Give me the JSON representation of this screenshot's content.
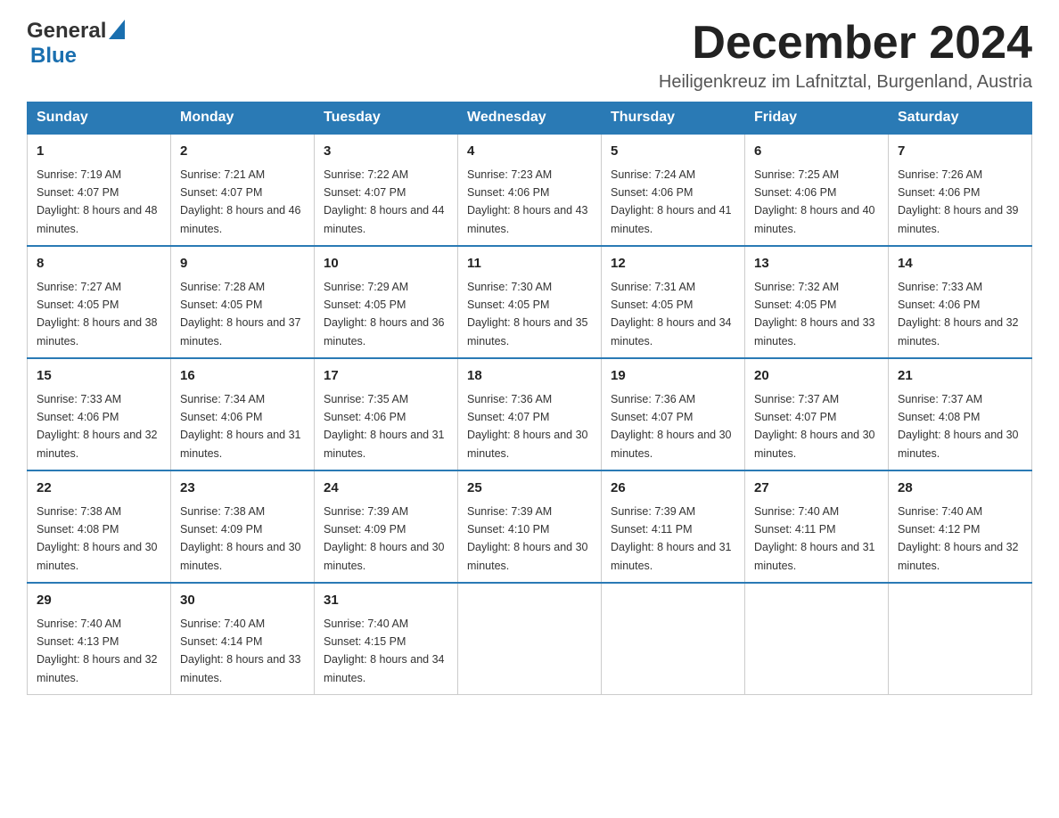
{
  "header": {
    "logo_general": "General",
    "logo_blue": "Blue",
    "month_title": "December 2024",
    "location": "Heiligenkreuz im Lafnitztal, Burgenland, Austria"
  },
  "days_of_week": [
    "Sunday",
    "Monday",
    "Tuesday",
    "Wednesday",
    "Thursday",
    "Friday",
    "Saturday"
  ],
  "weeks": [
    [
      {
        "day": "1",
        "sunrise": "7:19 AM",
        "sunset": "4:07 PM",
        "daylight": "8 hours and 48 minutes."
      },
      {
        "day": "2",
        "sunrise": "7:21 AM",
        "sunset": "4:07 PM",
        "daylight": "8 hours and 46 minutes."
      },
      {
        "day": "3",
        "sunrise": "7:22 AM",
        "sunset": "4:07 PM",
        "daylight": "8 hours and 44 minutes."
      },
      {
        "day": "4",
        "sunrise": "7:23 AM",
        "sunset": "4:06 PM",
        "daylight": "8 hours and 43 minutes."
      },
      {
        "day": "5",
        "sunrise": "7:24 AM",
        "sunset": "4:06 PM",
        "daylight": "8 hours and 41 minutes."
      },
      {
        "day": "6",
        "sunrise": "7:25 AM",
        "sunset": "4:06 PM",
        "daylight": "8 hours and 40 minutes."
      },
      {
        "day": "7",
        "sunrise": "7:26 AM",
        "sunset": "4:06 PM",
        "daylight": "8 hours and 39 minutes."
      }
    ],
    [
      {
        "day": "8",
        "sunrise": "7:27 AM",
        "sunset": "4:05 PM",
        "daylight": "8 hours and 38 minutes."
      },
      {
        "day": "9",
        "sunrise": "7:28 AM",
        "sunset": "4:05 PM",
        "daylight": "8 hours and 37 minutes."
      },
      {
        "day": "10",
        "sunrise": "7:29 AM",
        "sunset": "4:05 PM",
        "daylight": "8 hours and 36 minutes."
      },
      {
        "day": "11",
        "sunrise": "7:30 AM",
        "sunset": "4:05 PM",
        "daylight": "8 hours and 35 minutes."
      },
      {
        "day": "12",
        "sunrise": "7:31 AM",
        "sunset": "4:05 PM",
        "daylight": "8 hours and 34 minutes."
      },
      {
        "day": "13",
        "sunrise": "7:32 AM",
        "sunset": "4:05 PM",
        "daylight": "8 hours and 33 minutes."
      },
      {
        "day": "14",
        "sunrise": "7:33 AM",
        "sunset": "4:06 PM",
        "daylight": "8 hours and 32 minutes."
      }
    ],
    [
      {
        "day": "15",
        "sunrise": "7:33 AM",
        "sunset": "4:06 PM",
        "daylight": "8 hours and 32 minutes."
      },
      {
        "day": "16",
        "sunrise": "7:34 AM",
        "sunset": "4:06 PM",
        "daylight": "8 hours and 31 minutes."
      },
      {
        "day": "17",
        "sunrise": "7:35 AM",
        "sunset": "4:06 PM",
        "daylight": "8 hours and 31 minutes."
      },
      {
        "day": "18",
        "sunrise": "7:36 AM",
        "sunset": "4:07 PM",
        "daylight": "8 hours and 30 minutes."
      },
      {
        "day": "19",
        "sunrise": "7:36 AM",
        "sunset": "4:07 PM",
        "daylight": "8 hours and 30 minutes."
      },
      {
        "day": "20",
        "sunrise": "7:37 AM",
        "sunset": "4:07 PM",
        "daylight": "8 hours and 30 minutes."
      },
      {
        "day": "21",
        "sunrise": "7:37 AM",
        "sunset": "4:08 PM",
        "daylight": "8 hours and 30 minutes."
      }
    ],
    [
      {
        "day": "22",
        "sunrise": "7:38 AM",
        "sunset": "4:08 PM",
        "daylight": "8 hours and 30 minutes."
      },
      {
        "day": "23",
        "sunrise": "7:38 AM",
        "sunset": "4:09 PM",
        "daylight": "8 hours and 30 minutes."
      },
      {
        "day": "24",
        "sunrise": "7:39 AM",
        "sunset": "4:09 PM",
        "daylight": "8 hours and 30 minutes."
      },
      {
        "day": "25",
        "sunrise": "7:39 AM",
        "sunset": "4:10 PM",
        "daylight": "8 hours and 30 minutes."
      },
      {
        "day": "26",
        "sunrise": "7:39 AM",
        "sunset": "4:11 PM",
        "daylight": "8 hours and 31 minutes."
      },
      {
        "day": "27",
        "sunrise": "7:40 AM",
        "sunset": "4:11 PM",
        "daylight": "8 hours and 31 minutes."
      },
      {
        "day": "28",
        "sunrise": "7:40 AM",
        "sunset": "4:12 PM",
        "daylight": "8 hours and 32 minutes."
      }
    ],
    [
      {
        "day": "29",
        "sunrise": "7:40 AM",
        "sunset": "4:13 PM",
        "daylight": "8 hours and 32 minutes."
      },
      {
        "day": "30",
        "sunrise": "7:40 AM",
        "sunset": "4:14 PM",
        "daylight": "8 hours and 33 minutes."
      },
      {
        "day": "31",
        "sunrise": "7:40 AM",
        "sunset": "4:15 PM",
        "daylight": "8 hours and 34 minutes."
      },
      null,
      null,
      null,
      null
    ]
  ],
  "labels": {
    "sunrise_prefix": "Sunrise: ",
    "sunset_prefix": "Sunset: ",
    "daylight_prefix": "Daylight: "
  }
}
